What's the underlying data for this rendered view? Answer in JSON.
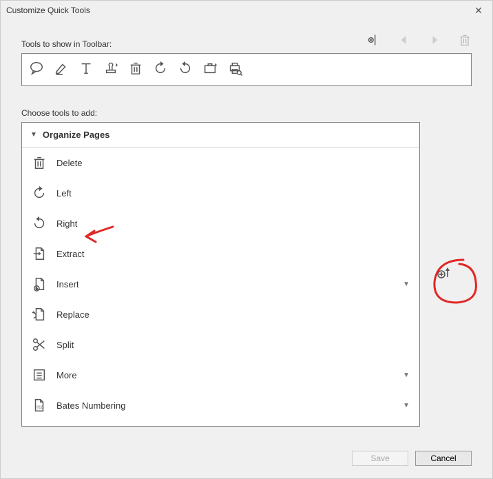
{
  "window_title": "Customize Quick Tools",
  "labels": {
    "tools_to_show": "Tools to show in Toolbar:",
    "choose_tools": "Choose tools to add:"
  },
  "top_actions": [
    {
      "name": "divider-add-icon"
    },
    {
      "name": "arrow-left-icon"
    },
    {
      "name": "arrow-right-icon"
    },
    {
      "name": "trash-icon"
    }
  ],
  "current_toolbar": [
    {
      "name": "comment-icon"
    },
    {
      "name": "highlight-icon"
    },
    {
      "name": "text-icon"
    },
    {
      "name": "stamp-icon"
    },
    {
      "name": "trash-icon"
    },
    {
      "name": "rotate-left-icon"
    },
    {
      "name": "rotate-right-icon"
    },
    {
      "name": "briefcase-icon"
    },
    {
      "name": "print-search-icon"
    }
  ],
  "group": {
    "name": "Organize Pages",
    "items": [
      {
        "label": "Delete",
        "icon": "trash-icon",
        "submenu": false
      },
      {
        "label": "Left",
        "icon": "rotate-left-icon",
        "submenu": false
      },
      {
        "label": "Right",
        "icon": "rotate-right-icon",
        "submenu": false
      },
      {
        "label": "Extract",
        "icon": "extract-icon",
        "submenu": false
      },
      {
        "label": "Insert",
        "icon": "insert-icon",
        "submenu": true
      },
      {
        "label": "Replace",
        "icon": "replace-icon",
        "submenu": false
      },
      {
        "label": "Split",
        "icon": "split-icon",
        "submenu": false
      },
      {
        "label": "More",
        "icon": "more-icon",
        "submenu": true
      },
      {
        "label": "Bates Numbering",
        "icon": "bates-icon",
        "submenu": true
      }
    ]
  },
  "side_action": {
    "name": "add-up-icon"
  },
  "buttons": {
    "save": "Save",
    "cancel": "Cancel"
  }
}
